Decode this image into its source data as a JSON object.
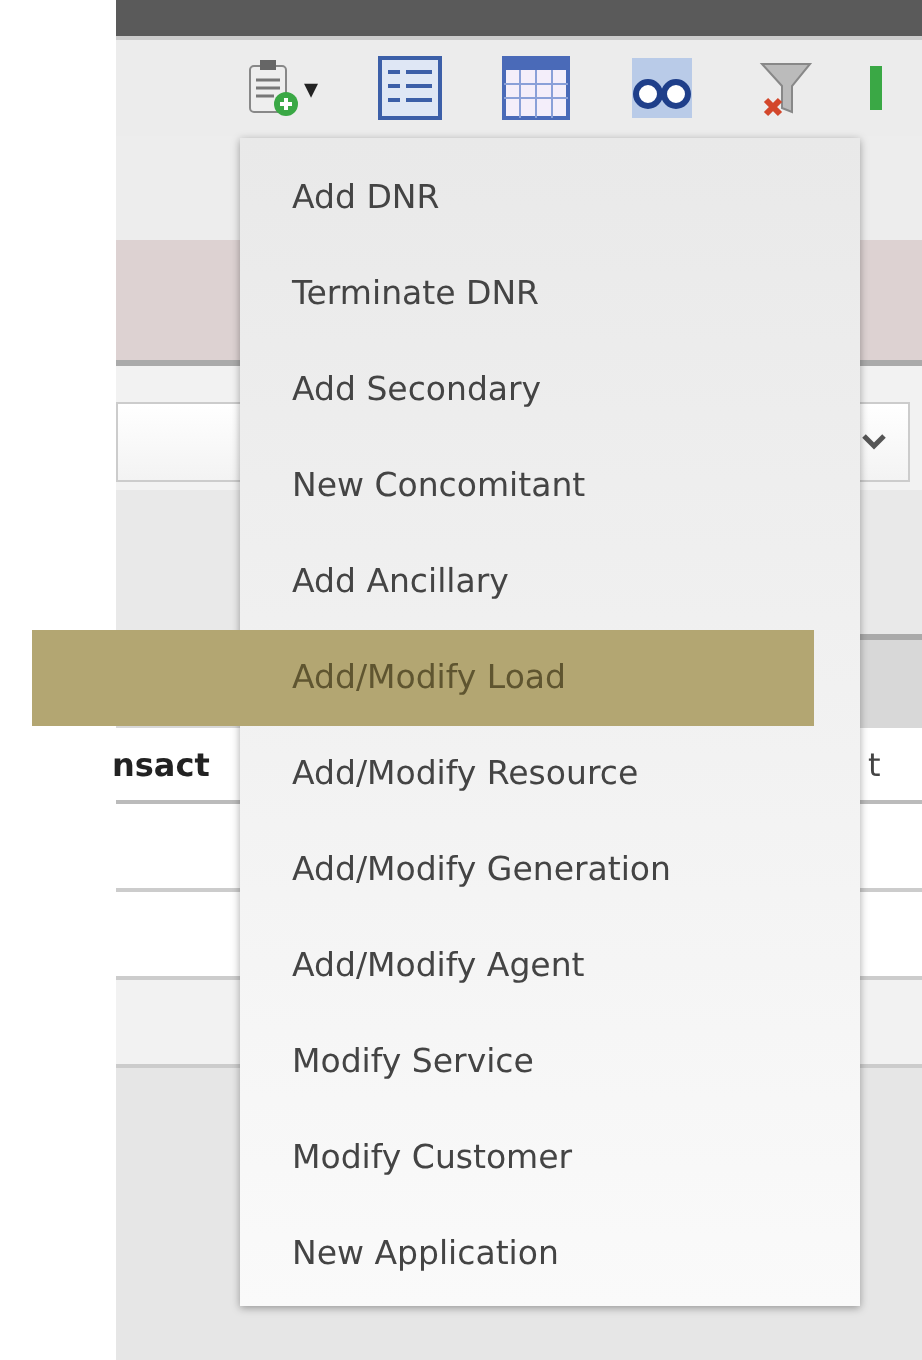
{
  "toolbar": {
    "dropdown_caret": "▾"
  },
  "table": {
    "header": {
      "column_1": "nsact",
      "column_2": "t"
    }
  },
  "menu": {
    "items": [
      {
        "label": "Add DNR",
        "selected": false
      },
      {
        "label": "Terminate DNR",
        "selected": false
      },
      {
        "label": "Add Secondary",
        "selected": false
      },
      {
        "label": "New Concomitant",
        "selected": false
      },
      {
        "label": "Add Ancillary",
        "selected": false
      },
      {
        "label": "Add/Modify Load",
        "selected": true
      },
      {
        "label": "Add/Modify Resource",
        "selected": false
      },
      {
        "label": "Add/Modify Generation",
        "selected": false
      },
      {
        "label": "Add/Modify Agent",
        "selected": false
      },
      {
        "label": "Modify Service",
        "selected": false
      },
      {
        "label": "Modify Customer",
        "selected": false
      },
      {
        "label": "New Application",
        "selected": false
      }
    ]
  }
}
